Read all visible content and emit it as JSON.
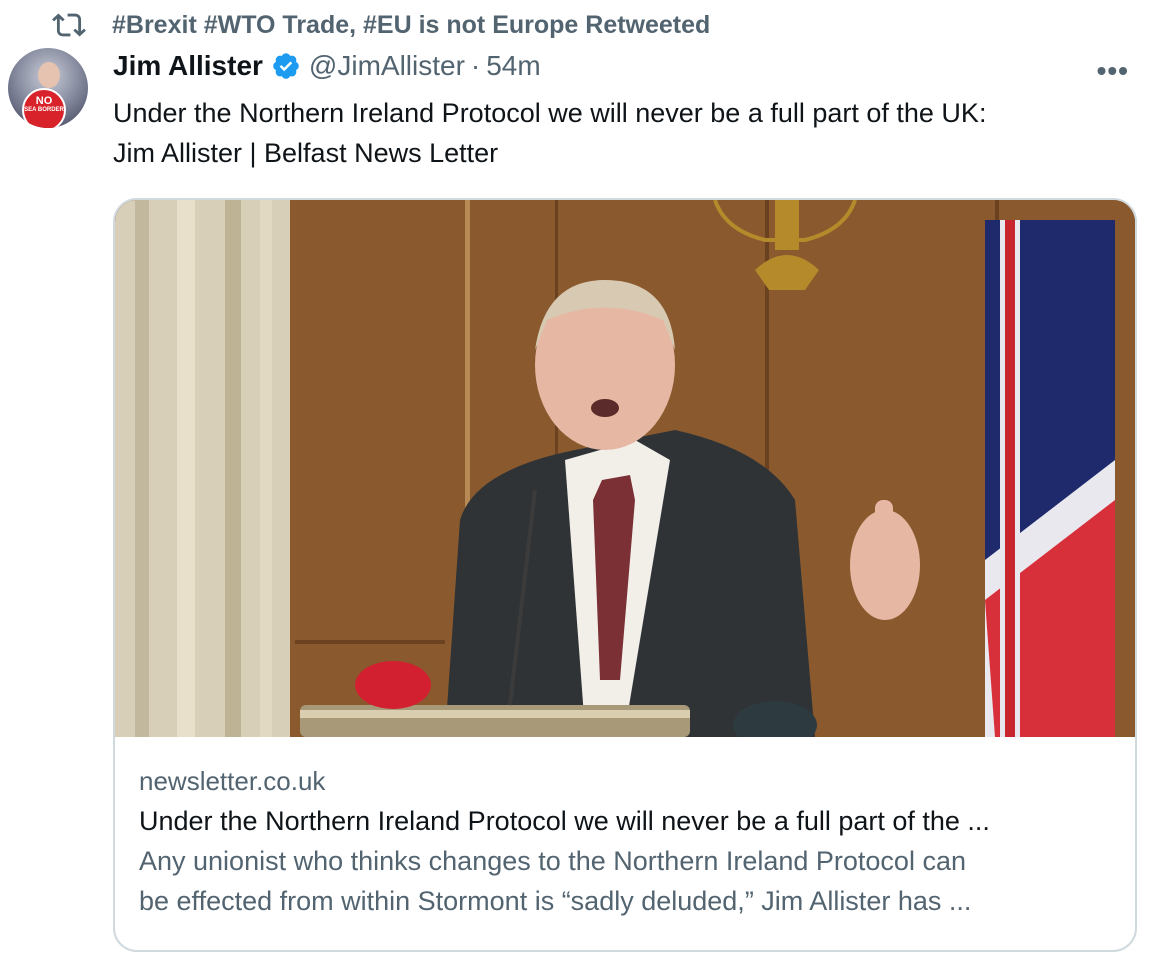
{
  "retweet": {
    "icon": "retweet-icon",
    "text": "#Brexit #WTO Trade, #EU is not Europe Retweeted"
  },
  "author": {
    "name": "Jim Allister",
    "handle": "@JimAllister",
    "separator": "·",
    "time": "54m",
    "verified_icon": "verified-badge-icon",
    "avatar_badge_line1": "NO",
    "avatar_badge_line2": "SEA BORDER"
  },
  "more_label": "•••",
  "tweet": {
    "text_line1": "Under the Northern Ireland Protocol we will never be a full part of the UK:",
    "text_line2": "Jim Allister | Belfast News Letter"
  },
  "card": {
    "domain": "newsletter.co.uk",
    "title": "Under the Northern Ireland Protocol we will never be a full part of the ...",
    "description_line1": "Any unionist who thinks changes to the Northern Ireland Protocol can",
    "description_line2": "be effected from within Stormont is “sadly deluded,” Jim Allister has ..."
  },
  "colors": {
    "text_primary": "#0f1419",
    "text_secondary": "#536471",
    "verified_blue": "#1d9bf0",
    "card_border": "#cfd9de"
  }
}
